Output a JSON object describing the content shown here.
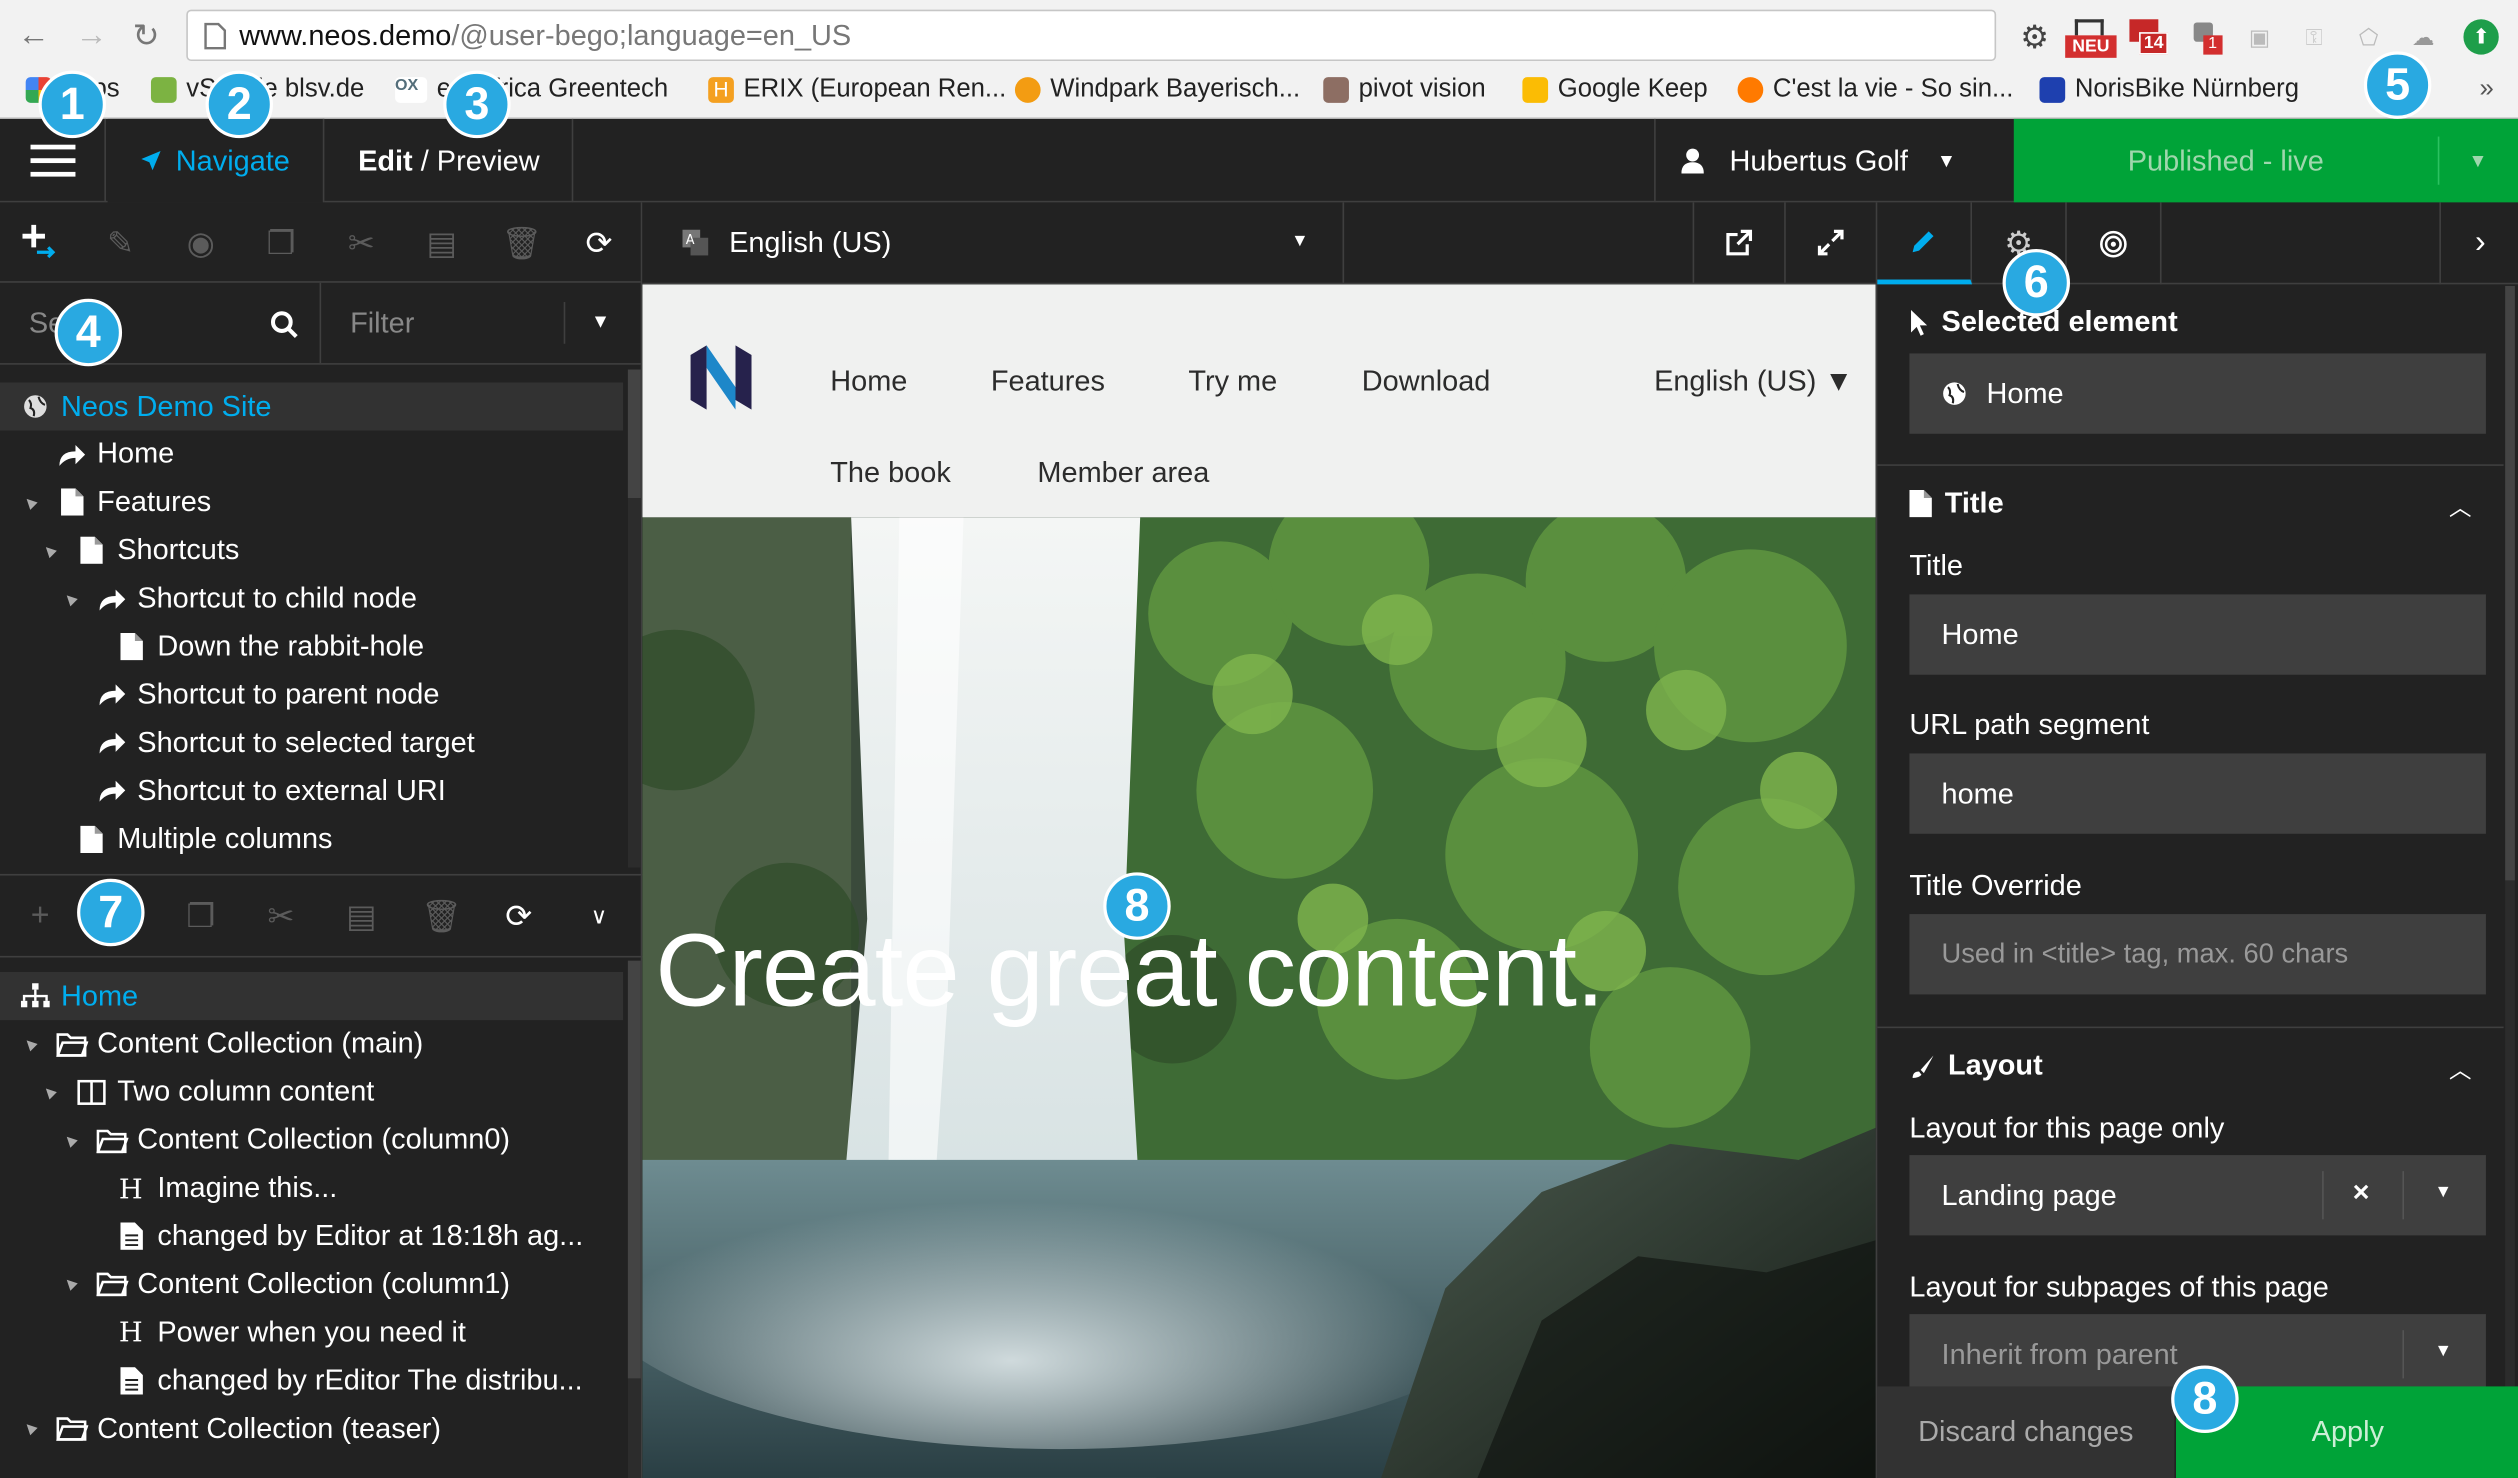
{
  "browser": {
    "url_host": "www.neos.demo",
    "url_path": "/@user-bego;language=en_US",
    "ext_neu": "NEU",
    "ext_count": "14",
    "ext_count2": "1",
    "bookmarks": [
      {
        "label": "Apps",
        "color": "#e94235"
      },
      {
        "label": "vSchule blsv.de",
        "color": "#7cb342"
      },
      {
        "label": "ecoafrica Greentech",
        "color": "#546e7a"
      },
      {
        "label": "ERIX (European Ren...",
        "color": "#f4a020"
      },
      {
        "label": "Windpark Bayerisch...",
        "color": "#f39c12"
      },
      {
        "label": "pivot vision",
        "color": "#8d6e63"
      },
      {
        "label": "Google Keep",
        "color": "#fbbc04"
      },
      {
        "label": "C'est la vie - So sin...",
        "color": "#ff7a00"
      },
      {
        "label": "NorisBike Nürnberg",
        "color": "#1e40af"
      }
    ]
  },
  "topbar": {
    "navigate_label": "Navigate",
    "edit_label": "Edit",
    "preview_label": "/ Preview",
    "user_name": "Hubertus Golf",
    "publish_label": "Published - live"
  },
  "left": {
    "search_placeholder": "Search",
    "filter_placeholder": "Filter",
    "page_tree": [
      {
        "label": "Neos Demo Site",
        "icon": "globe-icon",
        "indent": 0,
        "caret": "",
        "selected": true
      },
      {
        "label": "Home",
        "icon": "shortcut-icon",
        "indent": 1,
        "caret": ""
      },
      {
        "label": "Features",
        "icon": "document-icon",
        "indent": 1,
        "caret": "▲"
      },
      {
        "label": "Shortcuts",
        "icon": "document-icon",
        "indent": 2,
        "caret": "▲"
      },
      {
        "label": "Shortcut to child node",
        "icon": "shortcut-icon",
        "indent": 3,
        "caret": "▲"
      },
      {
        "label": "Down the rabbit-hole",
        "icon": "document-icon",
        "indent": 4,
        "caret": ""
      },
      {
        "label": "Shortcut to parent node",
        "icon": "shortcut-icon",
        "indent": 3,
        "caret": ""
      },
      {
        "label": "Shortcut to selected target",
        "icon": "shortcut-icon",
        "indent": 3,
        "caret": ""
      },
      {
        "label": "Shortcut to external URI",
        "icon": "shortcut-icon",
        "indent": 3,
        "caret": ""
      },
      {
        "label": "Multiple columns",
        "icon": "document-icon",
        "indent": 2,
        "caret": ""
      }
    ],
    "content_tree": [
      {
        "label": "Home",
        "icon": "sitemap-icon",
        "indent": 0,
        "caret": "",
        "selected": true
      },
      {
        "label": "Content Collection (main)",
        "icon": "folder-icon",
        "indent": 1,
        "caret": "▲"
      },
      {
        "label": "Two column content",
        "icon": "columns-icon",
        "indent": 2,
        "caret": "▲"
      },
      {
        "label": "Content Collection (column0)",
        "icon": "folder-icon",
        "indent": 3,
        "caret": "▲"
      },
      {
        "label": "Imagine this...",
        "icon": "heading-icon",
        "indent": 4,
        "caret": ""
      },
      {
        "label": "changed by Editor at 18:18h ag...",
        "icon": "text-icon",
        "indent": 4,
        "caret": ""
      },
      {
        "label": "Content Collection (column1)",
        "icon": "folder-icon",
        "indent": 3,
        "caret": "▲"
      },
      {
        "label": "Power when you need it",
        "icon": "heading-icon",
        "indent": 4,
        "caret": ""
      },
      {
        "label": "changed by rEditor The distribu...",
        "icon": "text-icon",
        "indent": 4,
        "caret": ""
      },
      {
        "label": "Content Collection (teaser)",
        "icon": "folder-icon",
        "indent": 1,
        "caret": "▲"
      }
    ]
  },
  "center": {
    "language_label": "English (US)",
    "site_nav": [
      "Home",
      "Features",
      "Try me",
      "Download",
      "The book",
      "Member area"
    ],
    "site_language": "English (US) ▼",
    "hero_title": "Create great content."
  },
  "right": {
    "selected_element_title": "Selected element",
    "selected_element_value": "Home",
    "title_section": "Title",
    "title_label": "Title",
    "title_value": "Home",
    "url_label": "URL path segment",
    "url_value": "home",
    "override_label": "Title Override",
    "override_placeholder": "Used in <title> tag, max. 60 chars",
    "layout_section": "Layout",
    "layout_page_label": "Layout for this page only",
    "layout_page_value": "Landing page",
    "layout_sub_label": "Layout for subpages of this page",
    "layout_sub_placeholder": "Inherit from parent",
    "discard_label": "Discard changes",
    "apply_label": "Apply"
  },
  "badges": [
    "1",
    "2",
    "3",
    "4",
    "5",
    "6",
    "7",
    "8",
    "8"
  ],
  "colors": {
    "accent": "#00adee",
    "publish": "#00a338",
    "badge": "#29a9e1",
    "panel": "#222222"
  }
}
